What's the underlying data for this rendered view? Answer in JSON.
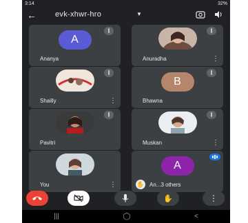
{
  "status": {
    "time": "3:14",
    "right": "32%"
  },
  "meeting": {
    "code": "evk-xhwr-hro"
  },
  "participants": [
    {
      "name": "Ananya",
      "initial": "A",
      "avatar_color": "#5b5bd6"
    },
    {
      "name": "Anuradha"
    },
    {
      "name": "Shailly"
    },
    {
      "name": "Bhawna",
      "initial": "B",
      "avatar_color": "#b5866c"
    },
    {
      "name": "Pavitri"
    },
    {
      "name": "Muskan"
    },
    {
      "name": "You"
    },
    {
      "name": "An...3 others",
      "initial": "A",
      "avatar_color": "#8e24aa"
    }
  ],
  "colors": {
    "background": "#202124",
    "tile": "#3c4043",
    "end_call": "#ea4335",
    "accent_blue": "#1a73e8"
  },
  "icons": {
    "back": "arrow-left-icon",
    "switch_camera": "switch-camera-icon",
    "speaker": "speaker-icon",
    "muted_mic": "mic-off-icon",
    "more": "more-vert-icon",
    "end_call": "call-end-icon",
    "camera_off": "camera-off-icon",
    "mic": "mic-icon",
    "raise_hand": "hand-icon",
    "menu": "more-vert-icon"
  }
}
